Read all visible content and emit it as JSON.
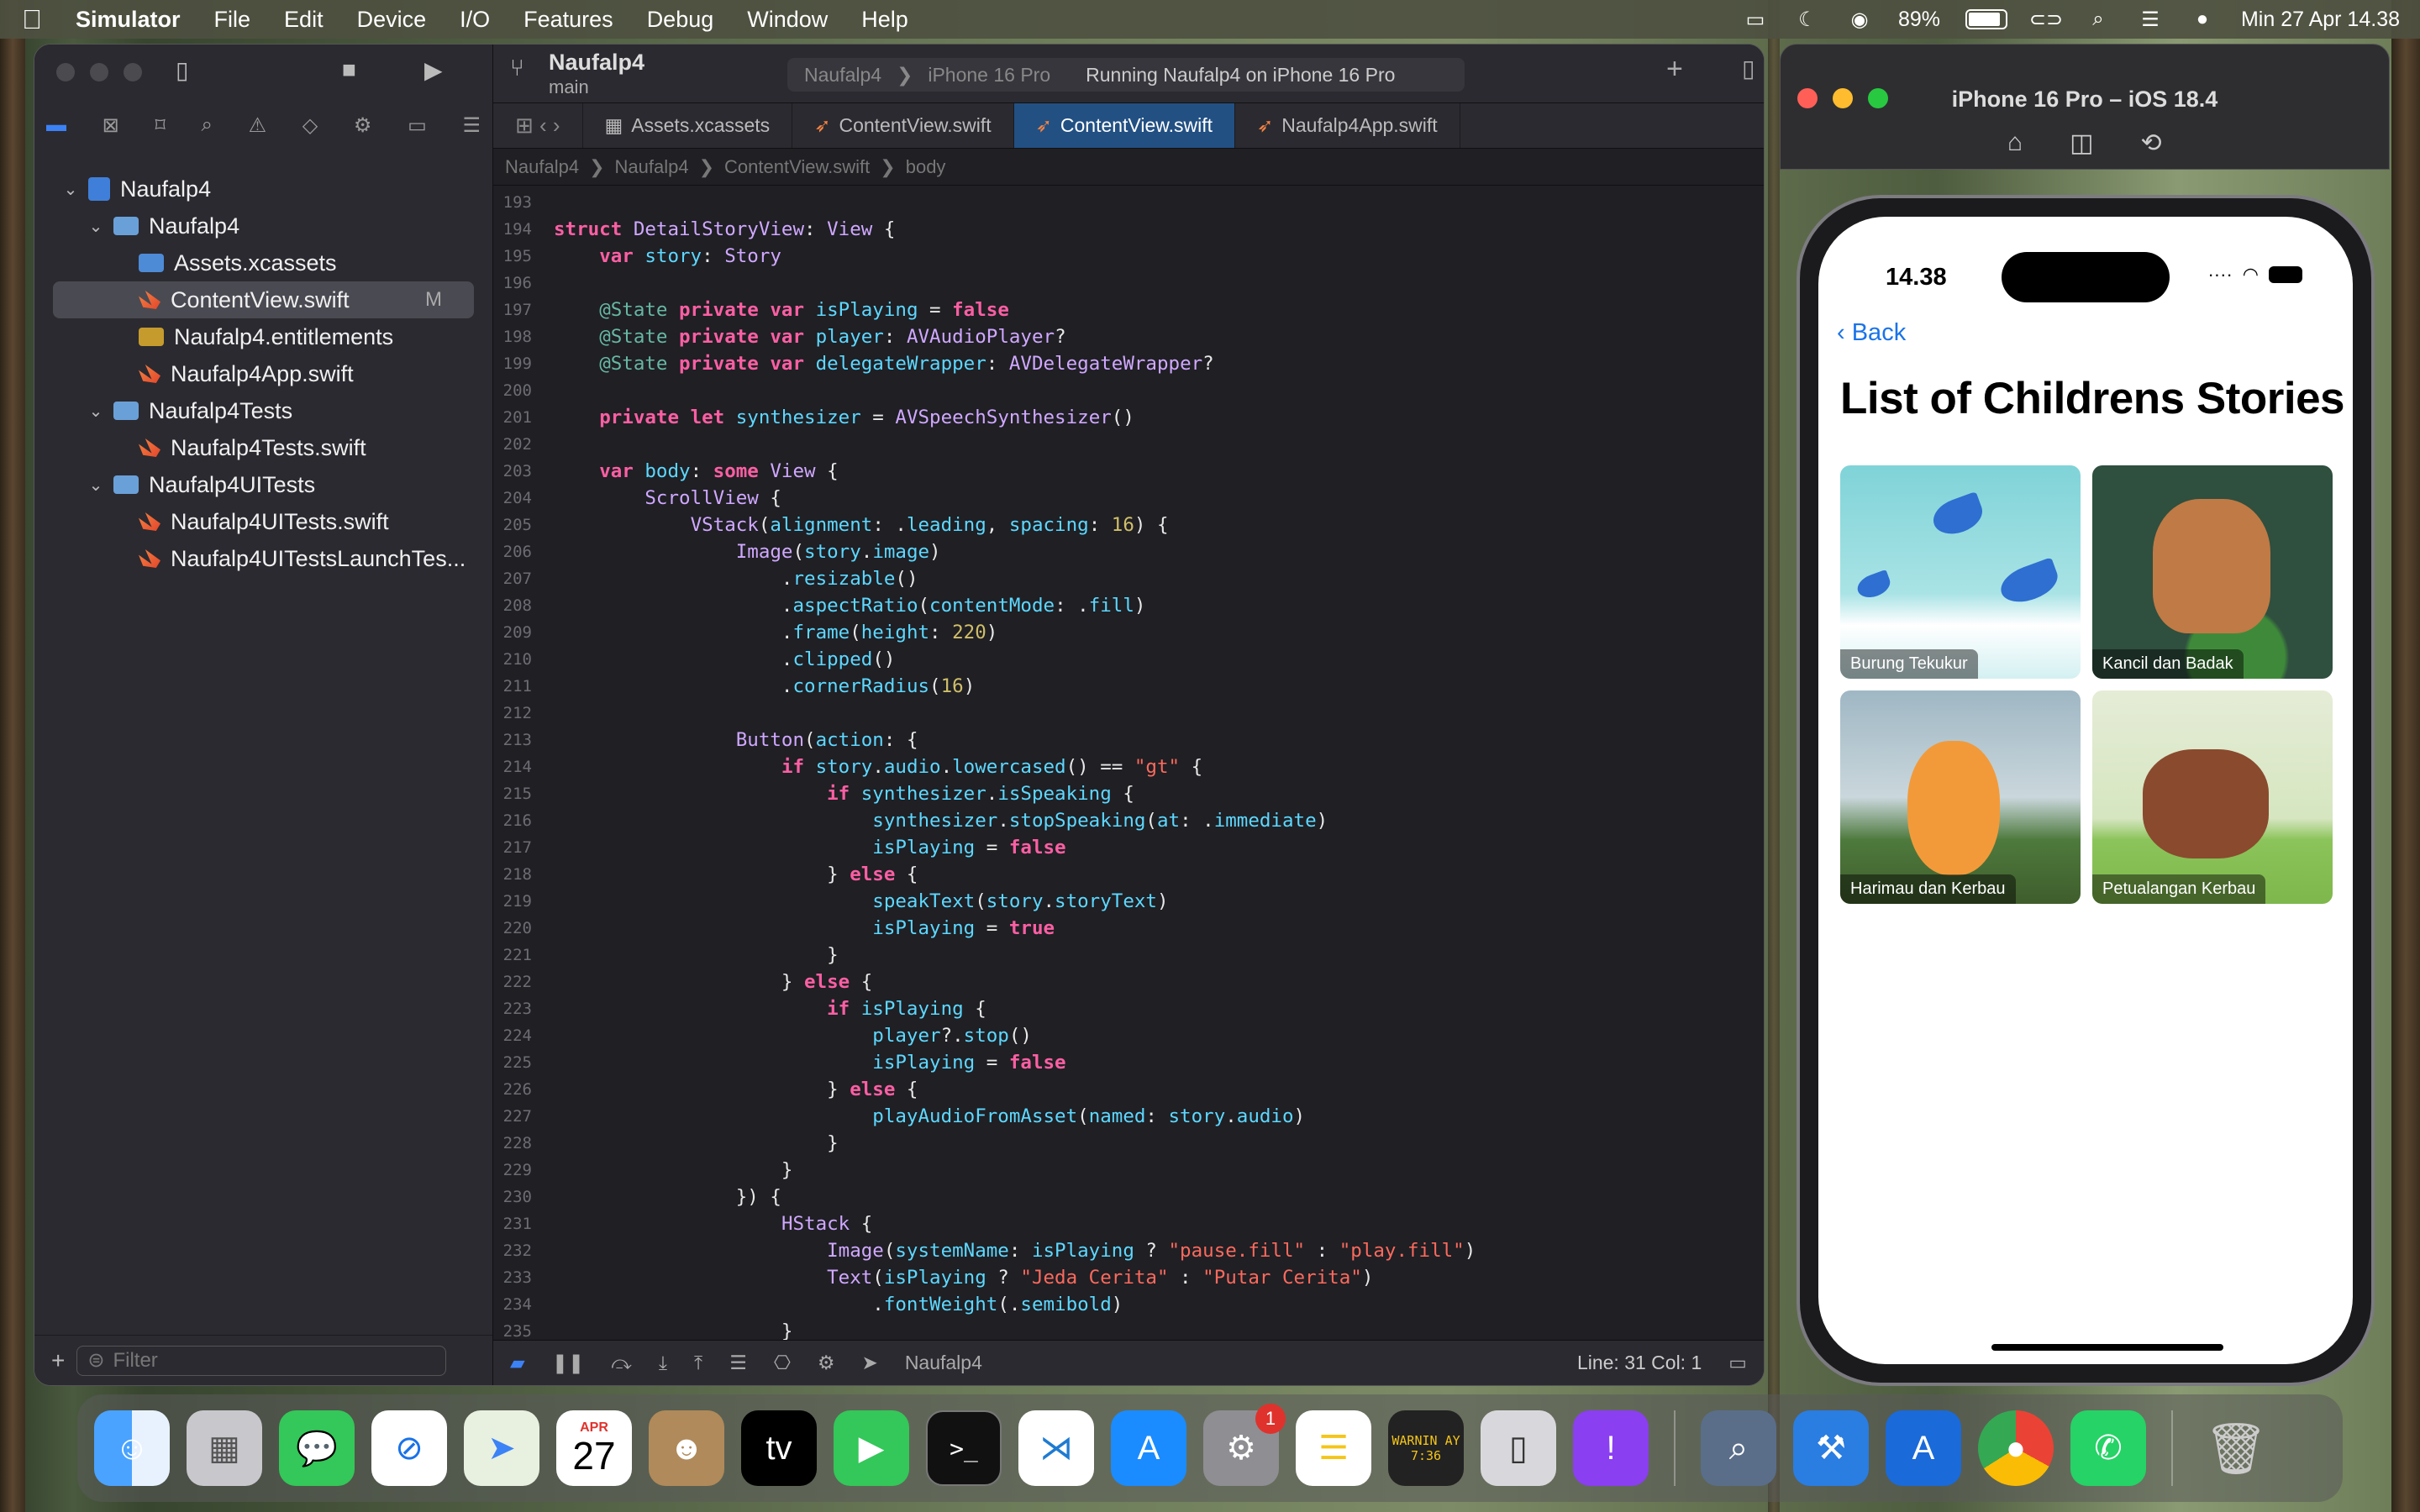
{
  "menubar": {
    "app": "Simulator",
    "items": [
      "File",
      "Edit",
      "Device",
      "I/O",
      "Features",
      "Debug",
      "Window",
      "Help"
    ],
    "battery": "89%",
    "datetime": "Min 27 Apr  14.38"
  },
  "xcode": {
    "project_name": "Naufalp4",
    "branch": "main",
    "scheme": {
      "target": "Naufalp4",
      "device": "iPhone 16 Pro",
      "status": "Running Naufalp4 on iPhone 16 Pro"
    },
    "tabs": [
      "Assets.xcassets",
      "ContentView.swift",
      "ContentView.swift",
      "Naufalp4App.swift"
    ],
    "jumpbar": [
      "Naufalp4",
      "Naufalp4",
      "ContentView.swift",
      "body"
    ],
    "navigator": {
      "rows": [
        {
          "label": "Naufalp4",
          "level": 0,
          "kind": "project",
          "chev": "⌄"
        },
        {
          "label": "Naufalp4",
          "level": 1,
          "kind": "folder",
          "chev": "⌄"
        },
        {
          "label": "Assets.xcassets",
          "level": 2,
          "kind": "assets",
          "chev": ""
        },
        {
          "label": "ContentView.swift",
          "level": 2,
          "kind": "swift",
          "chev": "",
          "selected": true,
          "badge": "M"
        },
        {
          "label": "Naufalp4.entitlements",
          "level": 2,
          "kind": "ent",
          "chev": ""
        },
        {
          "label": "Naufalp4App.swift",
          "level": 2,
          "kind": "swift",
          "chev": ""
        },
        {
          "label": "Naufalp4Tests",
          "level": 1,
          "kind": "folder",
          "chev": "⌄"
        },
        {
          "label": "Naufalp4Tests.swift",
          "level": 2,
          "kind": "swift",
          "chev": ""
        },
        {
          "label": "Naufalp4UITests",
          "level": 1,
          "kind": "folder",
          "chev": "⌄"
        },
        {
          "label": "Naufalp4UITests.swift",
          "level": 2,
          "kind": "swift",
          "chev": ""
        },
        {
          "label": "Naufalp4UITestsLaunchTes...",
          "level": 2,
          "kind": "swift",
          "chev": ""
        }
      ]
    },
    "filter_placeholder": "Filter",
    "status": {
      "scheme": "Naufalp4",
      "cursor": "Line: 31  Col: 1"
    },
    "code": [
      {
        "n": "193",
        "t": ""
      },
      {
        "n": "194",
        "t": "struct DetailStoryView: View {"
      },
      {
        "n": "195",
        "t": "    var story: Story"
      },
      {
        "n": "196",
        "t": ""
      },
      {
        "n": "197",
        "t": "    @State private var isPlaying = false"
      },
      {
        "n": "198",
        "t": "    @State private var player: AVAudioPlayer?"
      },
      {
        "n": "199",
        "t": "    @State private var delegateWrapper: AVDelegateWrapper?"
      },
      {
        "n": "200",
        "t": ""
      },
      {
        "n": "201",
        "t": "    private let synthesizer = AVSpeechSynthesizer()"
      },
      {
        "n": "202",
        "t": ""
      },
      {
        "n": "203",
        "t": "    var body: some View {"
      },
      {
        "n": "204",
        "t": "        ScrollView {"
      },
      {
        "n": "205",
        "t": "            VStack(alignment: .leading, spacing: 16) {"
      },
      {
        "n": "206",
        "t": "                Image(story.image)"
      },
      {
        "n": "207",
        "t": "                    .resizable()"
      },
      {
        "n": "208",
        "t": "                    .aspectRatio(contentMode: .fill)"
      },
      {
        "n": "209",
        "t": "                    .frame(height: 220)"
      },
      {
        "n": "210",
        "t": "                    .clipped()"
      },
      {
        "n": "211",
        "t": "                    .cornerRadius(16)"
      },
      {
        "n": "212",
        "t": ""
      },
      {
        "n": "213",
        "t": "                Button(action: {"
      },
      {
        "n": "214",
        "t": "                    if story.audio.lowercased() == \"gt\" {"
      },
      {
        "n": "215",
        "t": "                        if synthesizer.isSpeaking {"
      },
      {
        "n": "216",
        "t": "                            synthesizer.stopSpeaking(at: .immediate)"
      },
      {
        "n": "217",
        "t": "                            isPlaying = false"
      },
      {
        "n": "218",
        "t": "                        } else {"
      },
      {
        "n": "219",
        "t": "                            speakText(story.storyText)"
      },
      {
        "n": "220",
        "t": "                            isPlaying = true"
      },
      {
        "n": "221",
        "t": "                        }"
      },
      {
        "n": "222",
        "t": "                    } else {"
      },
      {
        "n": "223",
        "t": "                        if isPlaying {"
      },
      {
        "n": "224",
        "t": "                            player?.stop()"
      },
      {
        "n": "225",
        "t": "                            isPlaying = false"
      },
      {
        "n": "226",
        "t": "                        } else {"
      },
      {
        "n": "227",
        "t": "                            playAudioFromAsset(named: story.audio)"
      },
      {
        "n": "228",
        "t": "                        }"
      },
      {
        "n": "229",
        "t": "                    }"
      },
      {
        "n": "230",
        "t": "                }) {"
      },
      {
        "n": "231",
        "t": "                    HStack {"
      },
      {
        "n": "232",
        "t": "                        Image(systemName: isPlaying ? \"pause.fill\" : \"play.fill\")"
      },
      {
        "n": "233",
        "t": "                        Text(isPlaying ? \"Jeda Cerita\" : \"Putar Cerita\")"
      },
      {
        "n": "234",
        "t": "                            .fontWeight(.semibold)"
      },
      {
        "n": "235",
        "t": "                    }"
      }
    ]
  },
  "simulator": {
    "title": "iPhone 16 Pro – iOS 18.4",
    "phone": {
      "time": "14.38",
      "back": "Back",
      "title": "List of Childrens Stories",
      "stories": [
        "Burung Tekukur",
        "Kancil dan Badak",
        "Harimau dan Kerbau",
        "Petualangan Kerbau"
      ]
    }
  },
  "dock": {
    "calendar": {
      "month": "APR",
      "day": "27"
    },
    "settings_badge": "1",
    "console_text": "WARNIN AY 7:36"
  }
}
